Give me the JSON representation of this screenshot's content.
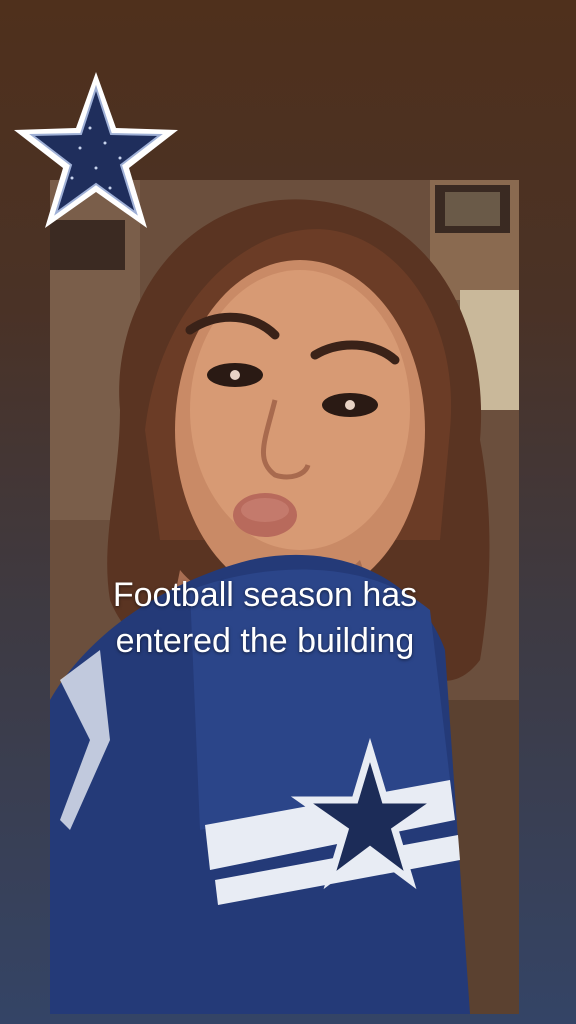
{
  "caption": {
    "text": "Football season has\nentered the building"
  },
  "sticker": {
    "icon": "dallas-star-icon",
    "color": "#1f2e5c"
  },
  "photo": {
    "subject": "selfie-in-blue-star-jersey"
  }
}
